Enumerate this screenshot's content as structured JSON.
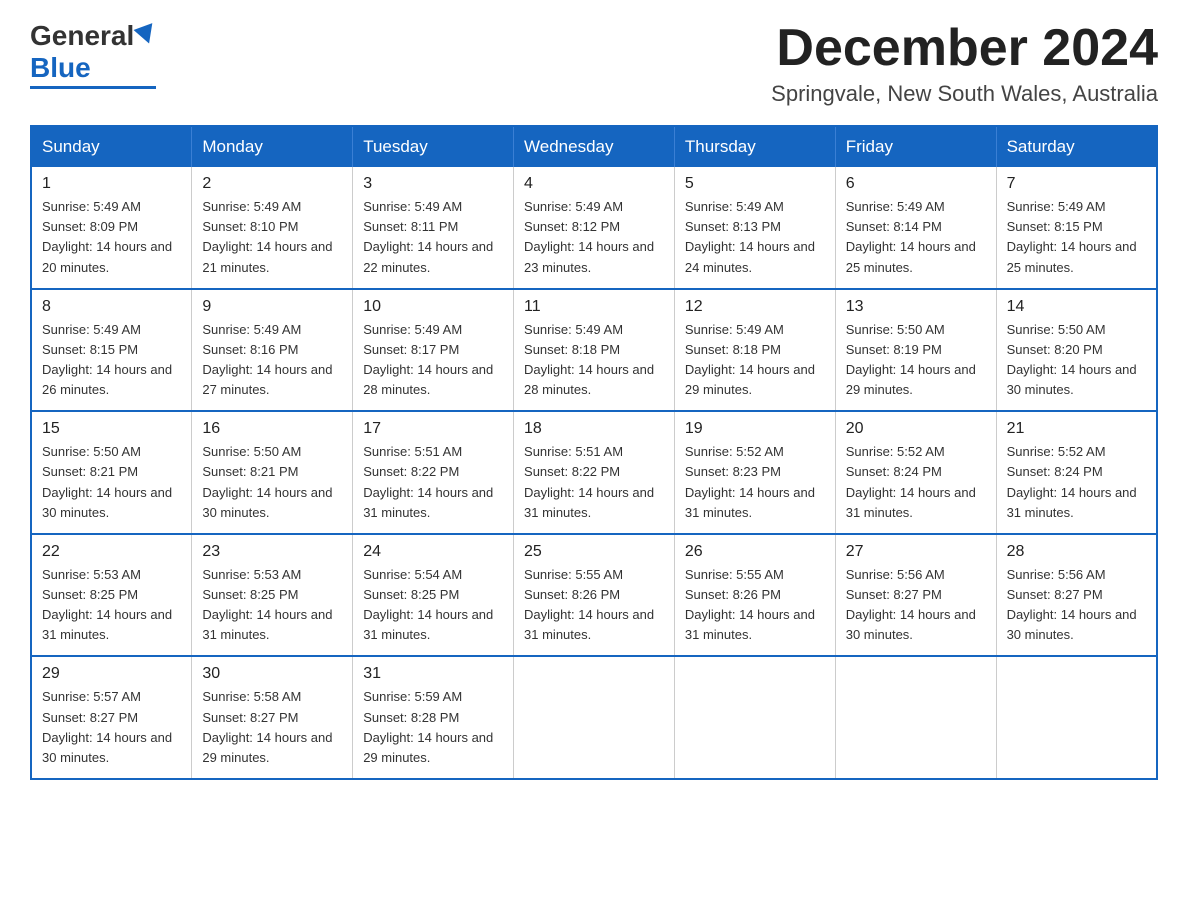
{
  "header": {
    "logo_general": "General",
    "logo_blue": "Blue",
    "month_title": "December 2024",
    "location": "Springvale, New South Wales, Australia"
  },
  "weekdays": [
    "Sunday",
    "Monday",
    "Tuesday",
    "Wednesday",
    "Thursday",
    "Friday",
    "Saturday"
  ],
  "weeks": [
    [
      {
        "day": "1",
        "sunrise": "Sunrise: 5:49 AM",
        "sunset": "Sunset: 8:09 PM",
        "daylight": "Daylight: 14 hours and 20 minutes."
      },
      {
        "day": "2",
        "sunrise": "Sunrise: 5:49 AM",
        "sunset": "Sunset: 8:10 PM",
        "daylight": "Daylight: 14 hours and 21 minutes."
      },
      {
        "day": "3",
        "sunrise": "Sunrise: 5:49 AM",
        "sunset": "Sunset: 8:11 PM",
        "daylight": "Daylight: 14 hours and 22 minutes."
      },
      {
        "day": "4",
        "sunrise": "Sunrise: 5:49 AM",
        "sunset": "Sunset: 8:12 PM",
        "daylight": "Daylight: 14 hours and 23 minutes."
      },
      {
        "day": "5",
        "sunrise": "Sunrise: 5:49 AM",
        "sunset": "Sunset: 8:13 PM",
        "daylight": "Daylight: 14 hours and 24 minutes."
      },
      {
        "day": "6",
        "sunrise": "Sunrise: 5:49 AM",
        "sunset": "Sunset: 8:14 PM",
        "daylight": "Daylight: 14 hours and 25 minutes."
      },
      {
        "day": "7",
        "sunrise": "Sunrise: 5:49 AM",
        "sunset": "Sunset: 8:15 PM",
        "daylight": "Daylight: 14 hours and 25 minutes."
      }
    ],
    [
      {
        "day": "8",
        "sunrise": "Sunrise: 5:49 AM",
        "sunset": "Sunset: 8:15 PM",
        "daylight": "Daylight: 14 hours and 26 minutes."
      },
      {
        "day": "9",
        "sunrise": "Sunrise: 5:49 AM",
        "sunset": "Sunset: 8:16 PM",
        "daylight": "Daylight: 14 hours and 27 minutes."
      },
      {
        "day": "10",
        "sunrise": "Sunrise: 5:49 AM",
        "sunset": "Sunset: 8:17 PM",
        "daylight": "Daylight: 14 hours and 28 minutes."
      },
      {
        "day": "11",
        "sunrise": "Sunrise: 5:49 AM",
        "sunset": "Sunset: 8:18 PM",
        "daylight": "Daylight: 14 hours and 28 minutes."
      },
      {
        "day": "12",
        "sunrise": "Sunrise: 5:49 AM",
        "sunset": "Sunset: 8:18 PM",
        "daylight": "Daylight: 14 hours and 29 minutes."
      },
      {
        "day": "13",
        "sunrise": "Sunrise: 5:50 AM",
        "sunset": "Sunset: 8:19 PM",
        "daylight": "Daylight: 14 hours and 29 minutes."
      },
      {
        "day": "14",
        "sunrise": "Sunrise: 5:50 AM",
        "sunset": "Sunset: 8:20 PM",
        "daylight": "Daylight: 14 hours and 30 minutes."
      }
    ],
    [
      {
        "day": "15",
        "sunrise": "Sunrise: 5:50 AM",
        "sunset": "Sunset: 8:21 PM",
        "daylight": "Daylight: 14 hours and 30 minutes."
      },
      {
        "day": "16",
        "sunrise": "Sunrise: 5:50 AM",
        "sunset": "Sunset: 8:21 PM",
        "daylight": "Daylight: 14 hours and 30 minutes."
      },
      {
        "day": "17",
        "sunrise": "Sunrise: 5:51 AM",
        "sunset": "Sunset: 8:22 PM",
        "daylight": "Daylight: 14 hours and 31 minutes."
      },
      {
        "day": "18",
        "sunrise": "Sunrise: 5:51 AM",
        "sunset": "Sunset: 8:22 PM",
        "daylight": "Daylight: 14 hours and 31 minutes."
      },
      {
        "day": "19",
        "sunrise": "Sunrise: 5:52 AM",
        "sunset": "Sunset: 8:23 PM",
        "daylight": "Daylight: 14 hours and 31 minutes."
      },
      {
        "day": "20",
        "sunrise": "Sunrise: 5:52 AM",
        "sunset": "Sunset: 8:24 PM",
        "daylight": "Daylight: 14 hours and 31 minutes."
      },
      {
        "day": "21",
        "sunrise": "Sunrise: 5:52 AM",
        "sunset": "Sunset: 8:24 PM",
        "daylight": "Daylight: 14 hours and 31 minutes."
      }
    ],
    [
      {
        "day": "22",
        "sunrise": "Sunrise: 5:53 AM",
        "sunset": "Sunset: 8:25 PM",
        "daylight": "Daylight: 14 hours and 31 minutes."
      },
      {
        "day": "23",
        "sunrise": "Sunrise: 5:53 AM",
        "sunset": "Sunset: 8:25 PM",
        "daylight": "Daylight: 14 hours and 31 minutes."
      },
      {
        "day": "24",
        "sunrise": "Sunrise: 5:54 AM",
        "sunset": "Sunset: 8:25 PM",
        "daylight": "Daylight: 14 hours and 31 minutes."
      },
      {
        "day": "25",
        "sunrise": "Sunrise: 5:55 AM",
        "sunset": "Sunset: 8:26 PM",
        "daylight": "Daylight: 14 hours and 31 minutes."
      },
      {
        "day": "26",
        "sunrise": "Sunrise: 5:55 AM",
        "sunset": "Sunset: 8:26 PM",
        "daylight": "Daylight: 14 hours and 31 minutes."
      },
      {
        "day": "27",
        "sunrise": "Sunrise: 5:56 AM",
        "sunset": "Sunset: 8:27 PM",
        "daylight": "Daylight: 14 hours and 30 minutes."
      },
      {
        "day": "28",
        "sunrise": "Sunrise: 5:56 AM",
        "sunset": "Sunset: 8:27 PM",
        "daylight": "Daylight: 14 hours and 30 minutes."
      }
    ],
    [
      {
        "day": "29",
        "sunrise": "Sunrise: 5:57 AM",
        "sunset": "Sunset: 8:27 PM",
        "daylight": "Daylight: 14 hours and 30 minutes."
      },
      {
        "day": "30",
        "sunrise": "Sunrise: 5:58 AM",
        "sunset": "Sunset: 8:27 PM",
        "daylight": "Daylight: 14 hours and 29 minutes."
      },
      {
        "day": "31",
        "sunrise": "Sunrise: 5:59 AM",
        "sunset": "Sunset: 8:28 PM",
        "daylight": "Daylight: 14 hours and 29 minutes."
      },
      null,
      null,
      null,
      null
    ]
  ]
}
